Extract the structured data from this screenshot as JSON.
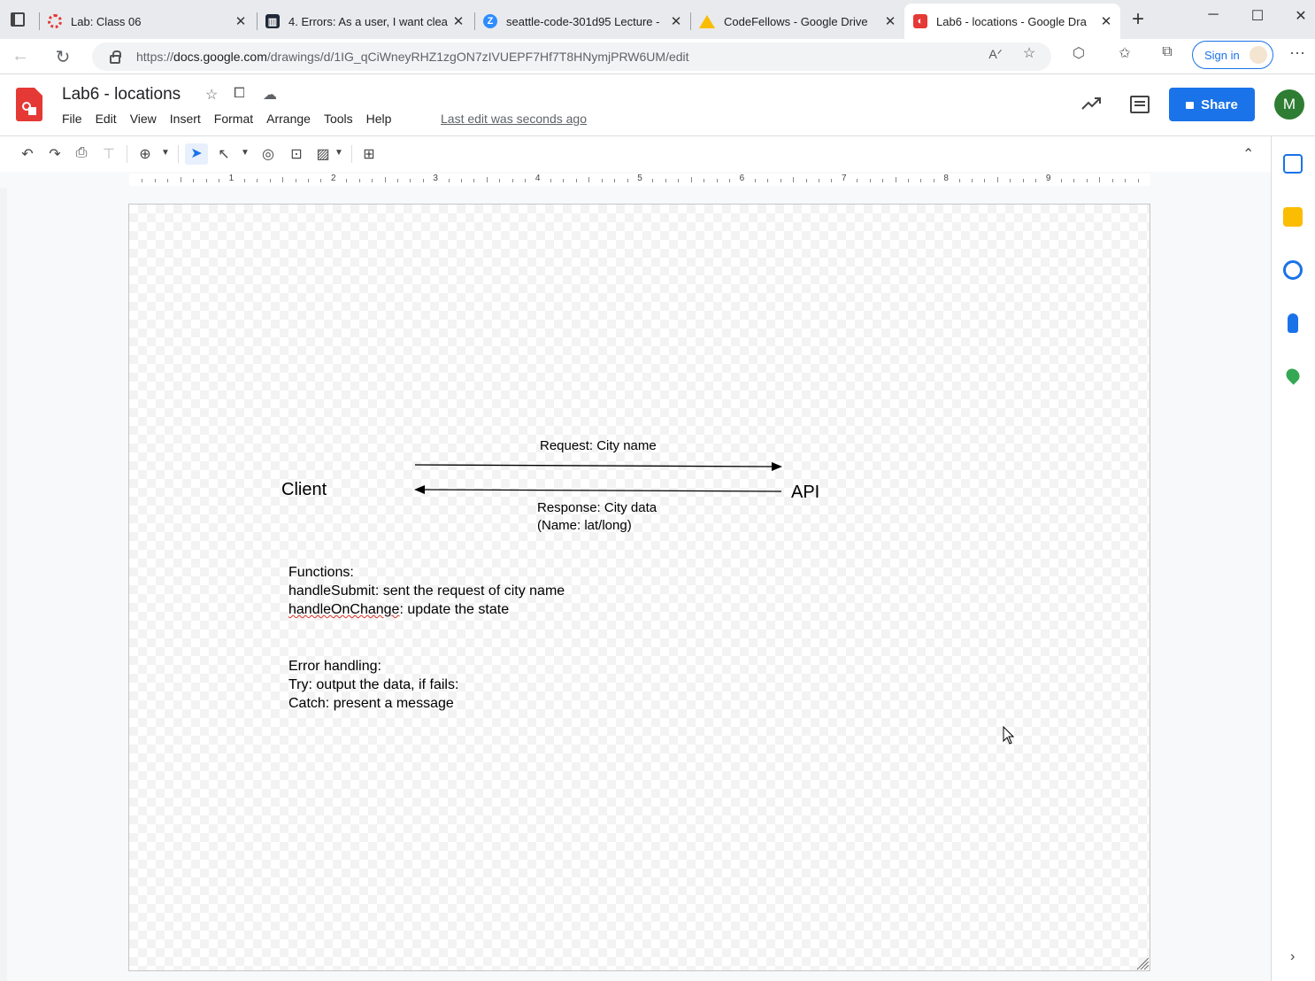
{
  "browser": {
    "tabs": [
      {
        "title": "Lab: Class 06",
        "favicon": "ring-icon",
        "color": "#e53935"
      },
      {
        "title": "4. Errors: As a user, I want clea",
        "favicon": "trello-icon",
        "color": "#1f2937"
      },
      {
        "title": "seattle-code-301d95 Lecture -",
        "favicon": "zoom-icon",
        "color": "#2d8cff"
      },
      {
        "title": "CodeFellows - Google Drive",
        "favicon": "drive-icon",
        "color": "#fbbc04"
      },
      {
        "title": "Lab6 - locations - Google Dra",
        "favicon": "drawings-icon",
        "color": "#e53935",
        "active": true
      }
    ],
    "url_prefix": "https://",
    "url_domain": "docs.google.com",
    "url_path": "/drawings/d/1IG_qCiWneyRHZ1zgON7zIVUEPF7Hf7T8HNymjPRW6UM/edit",
    "signin_label": "Sign in"
  },
  "app": {
    "title": "Lab6 - locations",
    "menu": [
      "File",
      "Edit",
      "View",
      "Insert",
      "Format",
      "Arrange",
      "Tools",
      "Help"
    ],
    "last_edit": "Last edit was seconds ago",
    "share_label": "Share",
    "avatar_initial": "M",
    "accent": "#1a73e8"
  },
  "ruler": {
    "numbers": [
      "1",
      "2",
      "3",
      "4",
      "5",
      "6",
      "7",
      "8",
      "9"
    ]
  },
  "drawing": {
    "client_label": "Client",
    "api_label": "API",
    "request_label": "Request: City name",
    "response_line1": "Response: City data",
    "response_line2": "(Name: lat/long)",
    "functions": {
      "heading": "Functions:",
      "line1_name": "handleSubmit",
      "line1_rest": ": sent the request of city name",
      "line2_name": "handleOnChange",
      "line2_rest": ": update the state"
    },
    "errors": {
      "heading": "Error handling:",
      "line1": "Try: output the data, if fails:",
      "line2": "Catch: present a message"
    }
  }
}
